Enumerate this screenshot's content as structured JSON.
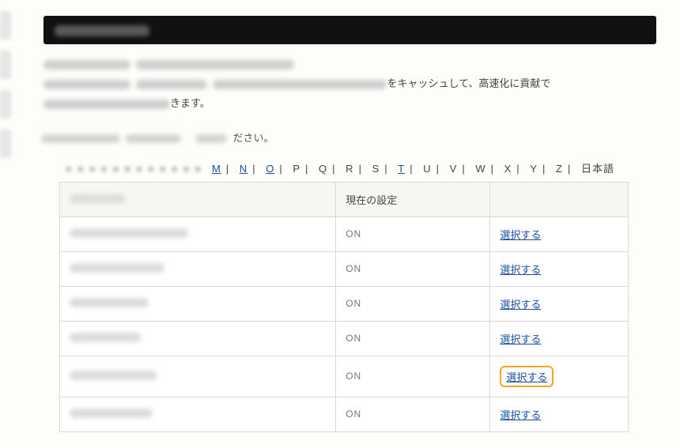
{
  "header": {
    "title": "（ぼかし）"
  },
  "intro": {
    "tail1": "をキャッシュして、高速化に貢献で",
    "tail2": "きます。"
  },
  "prompt_tail": "ださい。",
  "alpha": {
    "links": {
      "m": "M",
      "n": "N",
      "o": "O",
      "t": "T"
    },
    "plain": {
      "p": "P",
      "q": "Q",
      "r": "R",
      "s": "S",
      "u": "U",
      "v": "V",
      "w": "W",
      "x": "X",
      "y": "Y",
      "z": "Z",
      "jp": "日本語"
    }
  },
  "table": {
    "headers": {
      "domain": "",
      "current": "現在の設定",
      "action": ""
    },
    "rows": [
      {
        "status": "ON",
        "action": "選択する",
        "highlighted": false
      },
      {
        "status": "ON",
        "action": "選択する",
        "highlighted": false
      },
      {
        "status": "ON",
        "action": "選択する",
        "highlighted": false
      },
      {
        "status": "ON",
        "action": "選択する",
        "highlighted": false
      },
      {
        "status": "ON",
        "action": "選択する",
        "highlighted": true
      },
      {
        "status": "ON",
        "action": "選択する",
        "highlighted": false
      }
    ]
  }
}
